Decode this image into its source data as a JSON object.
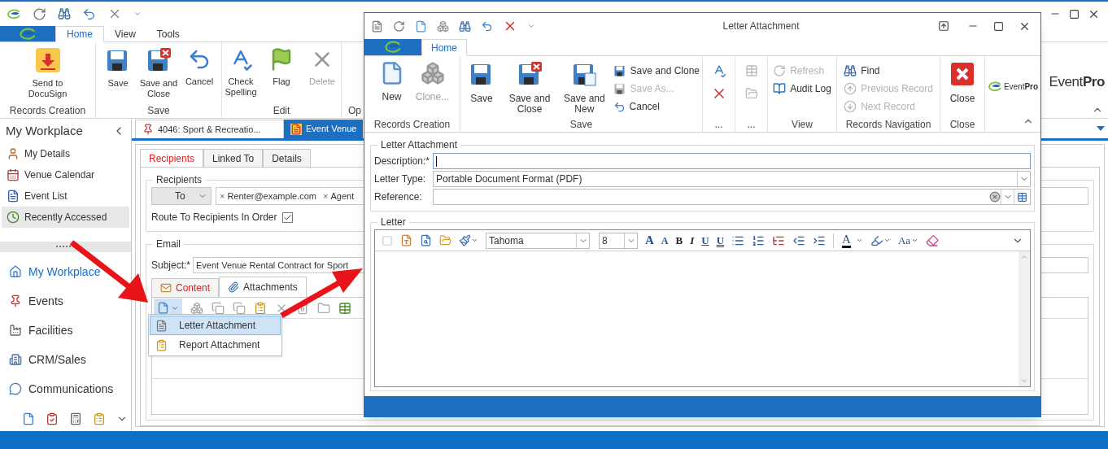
{
  "main_window": {
    "ribbon_tabs": [
      {
        "label": "Home",
        "selected": true
      },
      {
        "label": "View",
        "selected": false
      },
      {
        "label": "Tools",
        "selected": false
      }
    ],
    "ribbon_groups": [
      {
        "label": "Records Creation",
        "buttons": [
          {
            "label": "Send to DocuSign",
            "disabled": false
          }
        ]
      },
      {
        "label": "Save",
        "buttons": [
          {
            "label": "Save",
            "disabled": false
          },
          {
            "label": "Save and Close",
            "disabled": false
          },
          {
            "label": "Cancel",
            "disabled": false
          }
        ]
      },
      {
        "label": "Edit",
        "buttons": [
          {
            "label": "Check Spelling",
            "disabled": false
          },
          {
            "label": "Flag",
            "disabled": false
          },
          {
            "label": "Delete",
            "disabled": true
          }
        ]
      },
      {
        "label": "Op"
      }
    ],
    "logo": "Event**Pro**",
    "sidebar": {
      "title": "My Workplace",
      "items": [
        {
          "label": "My Details",
          "selected": false
        },
        {
          "label": "Venue Calendar",
          "selected": false
        },
        {
          "label": "Event List",
          "selected": false
        },
        {
          "label": "Recently Accessed",
          "selected": true
        }
      ],
      "nav": [
        {
          "label": "My Workplace",
          "selected": true
        },
        {
          "label": "Events",
          "selected": false
        },
        {
          "label": "Facilities",
          "selected": false
        },
        {
          "label": "CRM/Sales",
          "selected": false
        },
        {
          "label": "Communications",
          "selected": false
        }
      ]
    },
    "doc_tabs": [
      {
        "label": "4046: Sport & Recreatio...",
        "selected": false
      },
      {
        "label": "Event Venue",
        "selected": true
      }
    ],
    "record_tabs": [
      {
        "label": "Recipients",
        "selected": true
      },
      {
        "label": "Linked To",
        "selected": false
      },
      {
        "label": "Details",
        "selected": false
      }
    ],
    "recipients": {
      "title": "Recipients",
      "to": "To",
      "emails": [
        {
          "remove": "×",
          "address": "Renter@example.com"
        },
        {
          "remove": "×",
          "address": "Agent"
        }
      ],
      "route_label": "Route To Recipients In Order",
      "route_checked": true
    },
    "email": {
      "title": "Email",
      "subject_label": "Subject:*",
      "subject": "Event Venue Rental Contract for Sport",
      "tabs": [
        {
          "label": "Content",
          "selected": false
        },
        {
          "label": "Attachments",
          "selected": true
        }
      ]
    },
    "new_menu": [
      {
        "label": "Letter Attachment",
        "selected": true
      },
      {
        "label": "Report Attachment",
        "selected": false
      }
    ]
  },
  "dialog": {
    "title": "Letter Attachment",
    "tabs": [
      {
        "label": "Home",
        "selected": true
      }
    ],
    "ribbon_groups": [
      {
        "label": "Records Creation",
        "buttons": [
          {
            "label": "New",
            "kind": "large",
            "disabled": false
          },
          {
            "label": "Clone...",
            "kind": "large",
            "disabled": true
          }
        ]
      },
      {
        "label": "Save",
        "buttons": [
          {
            "label": "Save",
            "kind": "large",
            "disabled": false
          },
          {
            "label": "Save and Close",
            "kind": "large",
            "disabled": false
          },
          {
            "label": "Save and New",
            "kind": "large",
            "disabled": false
          },
          {
            "label": "Save and Clone",
            "kind": "small",
            "disabled": false
          },
          {
            "label": "Save As...",
            "kind": "small",
            "disabled": true
          },
          {
            "label": "Cancel",
            "kind": "small",
            "disabled": false
          }
        ]
      },
      {
        "label": "...",
        "buttons": [
          {
            "kind": "icon",
            "disabled": false
          },
          {
            "kind": "icon",
            "disabled": false
          }
        ]
      },
      {
        "label": "...",
        "buttons": [
          {
            "kind": "icon",
            "disabled": true
          },
          {
            "kind": "icon",
            "disabled": true
          }
        ]
      },
      {
        "label": "View",
        "buttons": [
          {
            "label": "Refresh",
            "kind": "small",
            "disabled": true
          },
          {
            "label": "Audit Log",
            "kind": "small",
            "disabled": false
          }
        ]
      },
      {
        "label": "Records Navigation",
        "buttons": [
          {
            "label": "Find",
            "kind": "small",
            "disabled": false
          },
          {
            "label": "Previous Record",
            "kind": "small",
            "disabled": true
          },
          {
            "label": "Next Record",
            "kind": "small",
            "disabled": true
          }
        ]
      },
      {
        "label": "Close",
        "buttons": [
          {
            "label": "Close",
            "kind": "large",
            "disabled": false
          }
        ]
      }
    ],
    "logo": "Event**Pro**",
    "form": {
      "title": "Letter Attachment",
      "fields": [
        {
          "label": "Description:*",
          "kind": "text",
          "focused": true
        },
        {
          "label": "Letter Type:",
          "kind": "combo",
          "value": "Portable Document Format (PDF)",
          "focused": false
        },
        {
          "label": "Reference:",
          "kind": "lookup",
          "focused": false
        }
      ]
    },
    "letter": {
      "title": "Letter",
      "toolbar": [
        {
          "kind": "icon",
          "disabled": true
        },
        {
          "kind": "icon",
          "disabled": false
        },
        {
          "kind": "icon",
          "disabled": false
        },
        {
          "kind": "icon",
          "disabled": false
        },
        {
          "kind": "icon",
          "disabled": false
        },
        {
          "kind": "font",
          "value": "Tahoma"
        },
        {
          "kind": "size",
          "value": "8"
        },
        {
          "kind": "grow",
          "text": "A"
        },
        {
          "kind": "shrink",
          "text": "A"
        },
        {
          "kind": "bold",
          "text": "B"
        },
        {
          "kind": "italic",
          "text": "I"
        },
        {
          "kind": "underline",
          "text": "U"
        },
        {
          "kind": "double-underline",
          "text": "U"
        },
        {
          "kind": "icon",
          "disabled": false
        },
        {
          "kind": "icon",
          "disabled": false
        },
        {
          "kind": "icon",
          "disabled": false
        },
        {
          "kind": "icon",
          "disabled": false
        },
        {
          "kind": "icon",
          "disabled": false
        },
        {
          "kind": "font-color",
          "text": "A"
        },
        {
          "kind": "icon",
          "disabled": false
        },
        {
          "kind": "case",
          "text": "Aa"
        },
        {
          "kind": "icon",
          "disabled": false
        }
      ]
    }
  }
}
